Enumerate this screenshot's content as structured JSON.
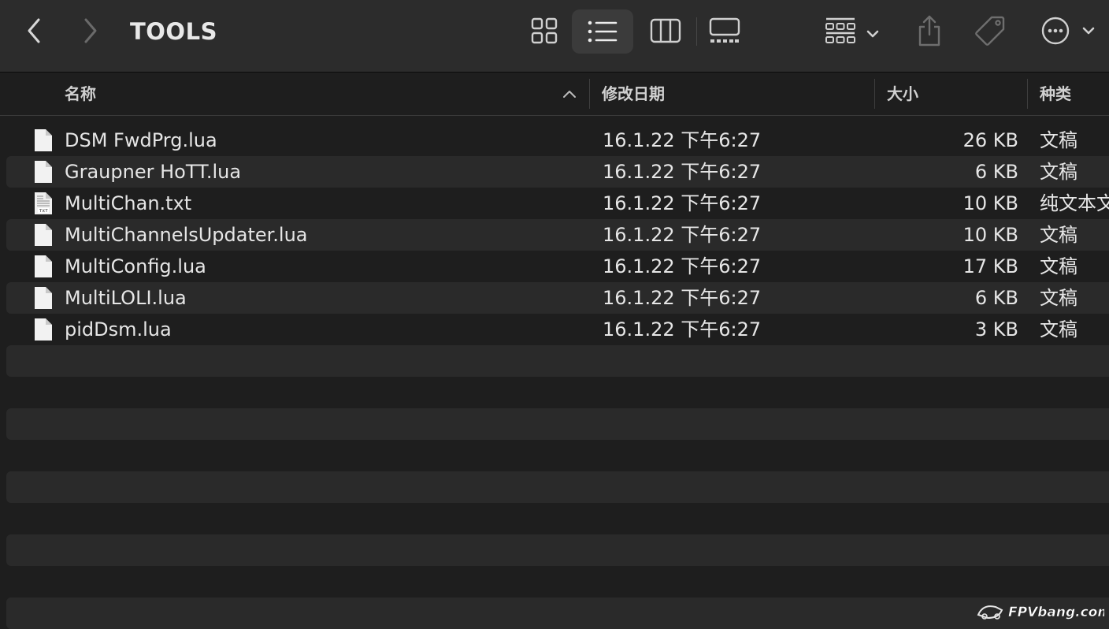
{
  "window": {
    "title": "TOOLS"
  },
  "toolbar": {
    "back_icon": "chevron-left-icon",
    "forward_icon": "chevron-right-icon",
    "views": [
      "icon-view",
      "list-view",
      "column-view",
      "gallery-view"
    ],
    "active_view": "list-view"
  },
  "columns": {
    "name": "名称",
    "date": "修改日期",
    "size": "大小",
    "kind": "种类",
    "sort_direction": "ascending"
  },
  "files": [
    {
      "name": "DSM FwdPrg.lua",
      "date": "16.1.22 下午6:27",
      "size": "26 KB",
      "kind": "文稿",
      "icon": "document-icon"
    },
    {
      "name": "Graupner HoTT.lua",
      "date": "16.1.22 下午6:27",
      "size": "6 KB",
      "kind": "文稿",
      "icon": "document-icon"
    },
    {
      "name": "MultiChan.txt",
      "date": "16.1.22 下午6:27",
      "size": "10 KB",
      "kind": "纯文本文",
      "icon": "text-file-icon"
    },
    {
      "name": "MultiChannelsUpdater.lua",
      "date": "16.1.22 下午6:27",
      "size": "10 KB",
      "kind": "文稿",
      "icon": "document-icon"
    },
    {
      "name": "MultiConfig.lua",
      "date": "16.1.22 下午6:27",
      "size": "17 KB",
      "kind": "文稿",
      "icon": "document-icon"
    },
    {
      "name": "MultiLOLI.lua",
      "date": "16.1.22 下午6:27",
      "size": "6 KB",
      "kind": "文稿",
      "icon": "document-icon"
    },
    {
      "name": "pidDsm.lua",
      "date": "16.1.22 下午6:27",
      "size": "3 KB",
      "kind": "文稿",
      "icon": "document-icon"
    }
  ],
  "watermark": {
    "text": "FPVbang.com"
  },
  "colors": {
    "toolbar_bg": "#2c2c2c",
    "list_bg": "#1e1e1e",
    "stripe": "#2a2a2a",
    "active_view_bg": "#3b3b3b",
    "text": "#e6e6e6"
  }
}
